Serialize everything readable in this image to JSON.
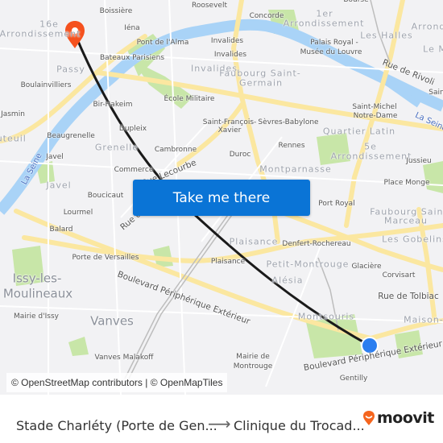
{
  "map": {
    "colors": {
      "background": "#f2f2f4",
      "water": "#a9d3f7",
      "park": "#c8e6a8",
      "major_road": "#fbe7a0",
      "route_line": "#1a1a1a",
      "destination_pin": "#f5511e",
      "origin_dot": "#2b7ef0"
    },
    "labels": {
      "boissiere": "Boissière",
      "roosevelt": "Roosevelt",
      "concorde": "Concorde",
      "bourse": "Bourse",
      "arr16_a": "16e",
      "arr16_b": "Arrondissement",
      "iena": "Iéna",
      "pont_alma": "Pont de l'Alma",
      "invalides1": "Invalides",
      "invalides2": "Invalides",
      "invalides_district": "Invalides",
      "arr1_a": "1er",
      "arr1_b": "Arrondissement",
      "palais_royal": "Palais Royal -",
      "louvre": "Musée du Louvre",
      "les_halles": "Les Halles",
      "arrond_right": "Arrond",
      "le_m": "Le M",
      "bateaux": "Bateaux Parisiens",
      "passy": "Passy",
      "boulainvilliers": "Boulainvilliers",
      "faubourg_sg_a": "Faubourg Saint-",
      "faubourg_sg_b": "Germain",
      "rue_rivoli": "Rue de Rivoli",
      "ecole_militaire": "École Militaire",
      "bir_hakeim": "Bir-Hakeim",
      "jasmin": "Jasmin",
      "saint_michel": "Saint-Michel",
      "notre_dame": "Notre-Dame",
      "saint_right": "Sain",
      "la_seine_right": "La Seine",
      "auteuil": "Auteuil",
      "saint_francois": "Saint-François-",
      "xavier": "Xavier",
      "sevres_babylone": "Sèvres-Babylone",
      "dupleix": "Dupleix",
      "quartier_latin": "Quartier Latin",
      "beaugrenelle": "Beaugrenelle",
      "grenelle": "Grenelle",
      "cambronne": "Cambronne",
      "rennes": "Rennes",
      "arr5_a": "5e",
      "arr5_b": "Arrondissement",
      "duroc": "Duroc",
      "javel1": "Javel",
      "la_seine": "La Seine",
      "jussieu": "Jussieu",
      "commerce": "Commerce",
      "lecourbe": "Rue Lecourbe",
      "montparnasse": "Montparnasse",
      "javel_district": "Javel",
      "place_monge": "Place Monge",
      "boucicaut": "Boucicaut",
      "port_royal": "Port Royal",
      "faubourg_sm_a": "Faubourg Saint-",
      "faubourg_sm_b": "Marceau",
      "lourmel": "Lourmel",
      "balard": "Balard",
      "rue_de": "Rue de",
      "les_gobelins": "Les Gobelins",
      "plaisance_district": "Plaisance",
      "denfert": "Denfert-Rochereau",
      "porte_versailles": "Porte de Versailles",
      "issy_a": "Issy-les-",
      "issy_b": "Moulineaux",
      "plaisance": "Plaisance",
      "petit_montrouge": "Petit-Montrouge",
      "glaciere": "Glacière",
      "corvisart": "Corvisart",
      "alesia": "Alésia",
      "rue_tolbiac": "Rue de Tolbiac",
      "mairie_issy": "Mairie d'Issy",
      "vanves": "Vanves",
      "bd_periph_w": "Boulevard Périphérique Extérieur",
      "montsouris": "Montsouris",
      "maison_b": "Maison-B",
      "bd_periph_e": "Boulevard Périphérique Extérieur",
      "vanves_malakoff": "Vanves Malakoff",
      "mairie_montrouge_a": "Mairie de",
      "mairie_montrouge_b": "Montrouge",
      "gentilly": "Gentilly"
    },
    "icons": {
      "destination": "map-pin-icon",
      "origin": "location-dot-icon"
    }
  },
  "cta": {
    "label": "Take me there"
  },
  "attribution": "© OpenStreetMap contributors | © OpenMapTiles",
  "footer": {
    "from": "Stade Charléty (Porte de Gen...",
    "arrow": "⟶",
    "to": "Clinique du Trocad...",
    "brand": "moovit",
    "brand_color": "#f5651e"
  }
}
